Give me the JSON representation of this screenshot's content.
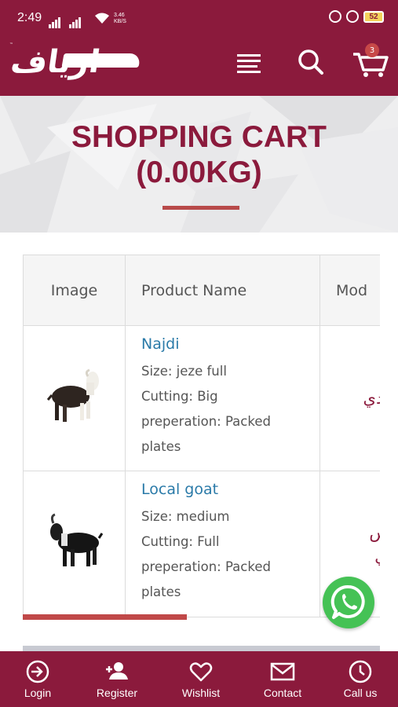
{
  "status_bar": {
    "time": "2:49",
    "speed_value": "3.46",
    "speed_unit": "KB/S",
    "battery": "52"
  },
  "header": {
    "logo_alt": "ارياف",
    "cart_count": "3",
    "brand_color": "#8b1a3c"
  },
  "hero": {
    "title_line1": "SHOPPING CART",
    "title_line2": "(0.00KG)"
  },
  "table": {
    "headers": [
      "Image",
      "Product Name",
      "Mod"
    ],
    "rows": [
      {
        "name": "Najdi",
        "options": [
          "Size: jeze full",
          "Cutting: Big",
          "preperation: Packed",
          "plates"
        ],
        "model": [
          "حدي"
        ]
      },
      {
        "name": "Local goat",
        "options": [
          "Size: medium",
          "Cutting: Full",
          "preperation: Packed",
          "plates"
        ],
        "model": [
          "بس",
          "دي"
        ]
      }
    ]
  },
  "bottom_nav": {
    "items": [
      {
        "label": "Login",
        "icon": "login-icon"
      },
      {
        "label": "Register",
        "icon": "register-icon"
      },
      {
        "label": "Wishlist",
        "icon": "heart-icon"
      },
      {
        "label": "Contact",
        "icon": "mail-icon"
      },
      {
        "label": "Call us",
        "icon": "phone-icon"
      }
    ]
  }
}
